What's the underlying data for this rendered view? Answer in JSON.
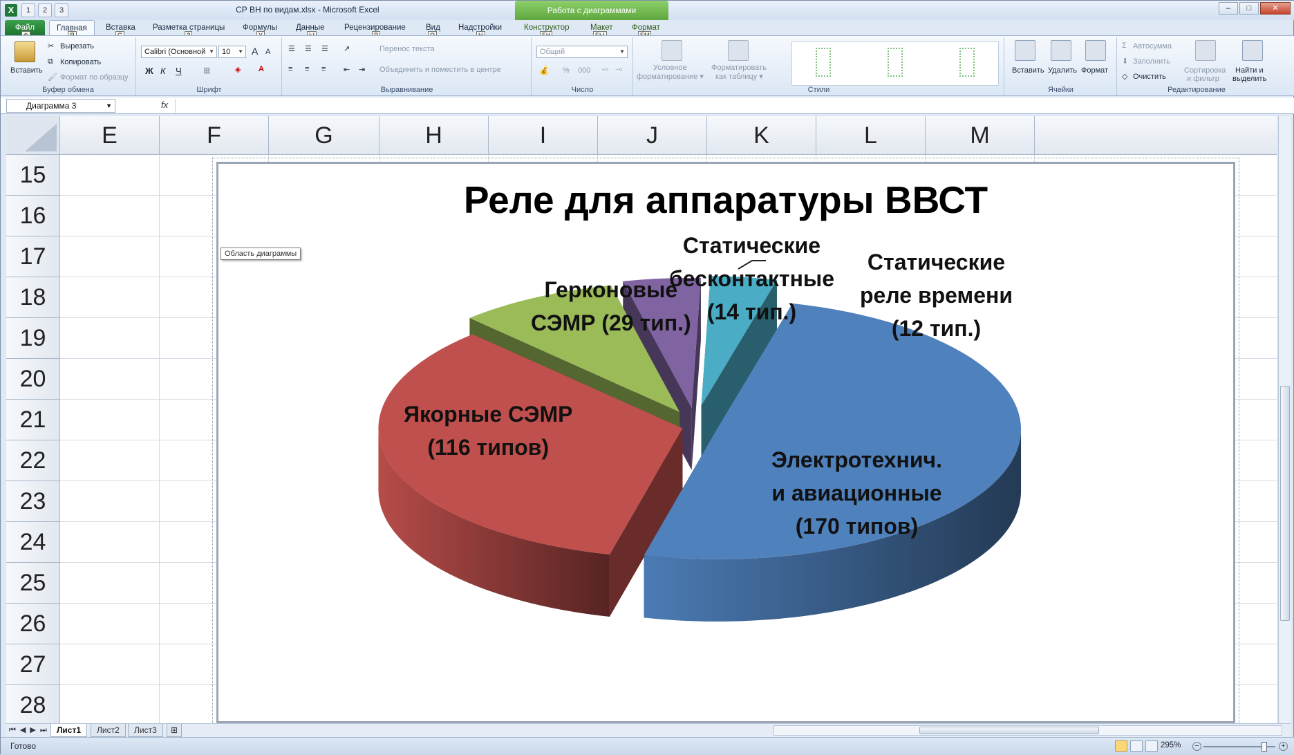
{
  "window": {
    "title": "СР ВН по видам.xlsx  -  Microsoft Excel",
    "contextual_title": "Работа с диаграммами",
    "app_icon": "X",
    "controls": [
      "–",
      "□",
      "✕"
    ]
  },
  "qat_keytips": [
    "1",
    "2",
    "3"
  ],
  "tabs": [
    {
      "label": "Файл",
      "keytip": "Ф"
    },
    {
      "label": "Главная",
      "keytip": "Я"
    },
    {
      "label": "Вставка",
      "keytip": "С"
    },
    {
      "label": "Разметка страницы",
      "keytip": "З"
    },
    {
      "label": "Формулы",
      "keytip": "У"
    },
    {
      "label": "Данные",
      "keytip": "Ы"
    },
    {
      "label": "Рецензирование",
      "keytip": "Р"
    },
    {
      "label": "Вид",
      "keytip": "О"
    },
    {
      "label": "Надстройки",
      "keytip": "Н"
    },
    {
      "label": "Конструктор",
      "keytip": "БН"
    },
    {
      "label": "Макет",
      "keytip": "БЫ"
    },
    {
      "label": "Формат",
      "keytip": "БМ"
    }
  ],
  "ribbon": {
    "clipboard": {
      "label": "Буфер обмена",
      "paste": "Вставить",
      "cut": "Вырезать",
      "copy": "Копировать",
      "format_painter": "Формат по образцу"
    },
    "font": {
      "label": "Шрифт",
      "font_name": "Calibri (Основной",
      "font_size": "10",
      "bold": "Ж",
      "italic": "К",
      "underline": "Ч",
      "grow": "A",
      "shrink": "A"
    },
    "alignment": {
      "label": "Выравнивание",
      "wrap": "Перенос текста",
      "merge": "Объединить и поместить в центре"
    },
    "number": {
      "label": "Число",
      "format": "Общий",
      "percent": "%",
      "thousands": "000"
    },
    "styles": {
      "label": "Стили",
      "conditional_1": "Условное",
      "conditional_2": "форматирование",
      "as_table_1": "Форматировать",
      "as_table_2": "как таблицу"
    },
    "cells": {
      "label": "Ячейки",
      "insert": "Вставить",
      "delete": "Удалить",
      "format": "Формат"
    },
    "editing": {
      "label": "Редактирование",
      "autosum": "Автосумма",
      "fill": "Заполнить",
      "clear": "Очистить",
      "sort_1": "Сортировка",
      "sort_2": "и фильтр",
      "find_1": "Найти и",
      "find_2": "выделить"
    }
  },
  "formula_bar": {
    "name_box": "Диаграмма 3",
    "fx": "fx",
    "value": ""
  },
  "columns": [
    "E",
    "F",
    "G",
    "H",
    "I",
    "J",
    "K",
    "L",
    "M"
  ],
  "rows": [
    "15",
    "16",
    "17",
    "18",
    "19",
    "20",
    "21",
    "22",
    "23",
    "24",
    "25",
    "26",
    "27",
    "28"
  ],
  "chart_tooltip": "Область диаграммы",
  "chart_data": {
    "type": "pie",
    "title": "Реле для аппаратуры ВВСТ",
    "exploded": true,
    "three_d": true,
    "legend": "none",
    "series": [
      {
        "name": "",
        "values": [
          {
            "label_lines": [
              "Электротехнич.",
              "и авиационные",
              "(170 типов)"
            ],
            "value": 170,
            "color": "#4f81bd"
          },
          {
            "label_lines": [
              "Якорные СЭМР",
              "(116 типов)"
            ],
            "value": 116,
            "color": "#c0504d"
          },
          {
            "label_lines": [
              "Герконовые",
              "СЭМР (29 тип.)"
            ],
            "value": 29,
            "color": "#9bbb59"
          },
          {
            "label_lines": [
              "Статические",
              "бесконтактные",
              "(14 тип.)"
            ],
            "value": 14,
            "color": "#8064a2"
          },
          {
            "label_lines": [
              "Статические",
              "реле времени",
              "(12 тип.)"
            ],
            "value": 12,
            "color": "#4bacc6"
          }
        ]
      }
    ]
  },
  "sheets": [
    {
      "label": "Лист1",
      "active": true
    },
    {
      "label": "Лист2",
      "active": false
    },
    {
      "label": "Лист3",
      "active": false
    }
  ],
  "status": {
    "ready": "Готово",
    "zoom": "295%"
  }
}
